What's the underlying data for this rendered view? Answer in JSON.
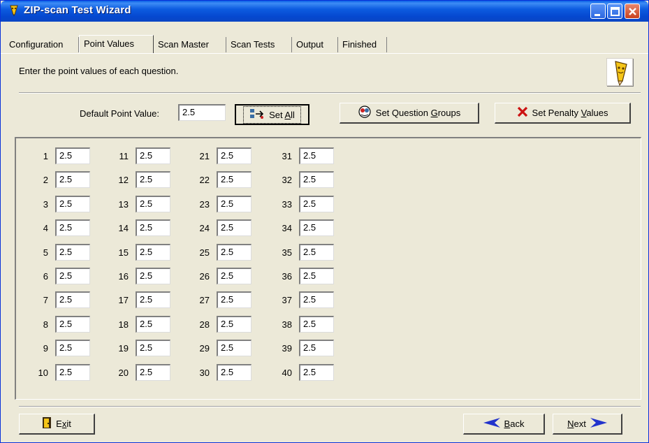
{
  "window": {
    "title": "ZIP-scan Test Wizard",
    "icon": "pencil-icon",
    "controls": [
      "minimize",
      "maximize",
      "close"
    ]
  },
  "tabs": [
    {
      "label": "Configuration",
      "active": false
    },
    {
      "label": "Point Values",
      "active": true
    },
    {
      "label": "Scan Master",
      "active": false
    },
    {
      "label": "Scan Tests",
      "active": false
    },
    {
      "label": "Output",
      "active": false
    },
    {
      "label": "Finished",
      "active": false
    }
  ],
  "instruction": "Enter the point values of each question.",
  "default_point": {
    "label": "Default Point Value:",
    "value": "2.5"
  },
  "buttons": {
    "set_all": {
      "label_pre": "Set ",
      "label_u": "A",
      "label_post": "ll"
    },
    "set_groups": {
      "label_pre": "Set Question ",
      "label_u": "G",
      "label_post": "roups"
    },
    "set_penalty": {
      "label_pre": "Set Penalty ",
      "label_u": "V",
      "label_post": "alues"
    },
    "exit": {
      "label_pre": "E",
      "label_u": "x",
      "label_post": "it"
    },
    "back": {
      "label_pre": "",
      "label_u": "B",
      "label_post": "ack"
    },
    "next": {
      "label_pre": "",
      "label_u": "N",
      "label_post": "ext"
    }
  },
  "questions": [
    {
      "num": "1",
      "value": "2.5"
    },
    {
      "num": "2",
      "value": "2.5"
    },
    {
      "num": "3",
      "value": "2.5"
    },
    {
      "num": "4",
      "value": "2.5"
    },
    {
      "num": "5",
      "value": "2.5"
    },
    {
      "num": "6",
      "value": "2.5"
    },
    {
      "num": "7",
      "value": "2.5"
    },
    {
      "num": "8",
      "value": "2.5"
    },
    {
      "num": "9",
      "value": "2.5"
    },
    {
      "num": "10",
      "value": "2.5"
    },
    {
      "num": "11",
      "value": "2.5"
    },
    {
      "num": "12",
      "value": "2.5"
    },
    {
      "num": "13",
      "value": "2.5"
    },
    {
      "num": "14",
      "value": "2.5"
    },
    {
      "num": "15",
      "value": "2.5"
    },
    {
      "num": "16",
      "value": "2.5"
    },
    {
      "num": "17",
      "value": "2.5"
    },
    {
      "num": "18",
      "value": "2.5"
    },
    {
      "num": "19",
      "value": "2.5"
    },
    {
      "num": "20",
      "value": "2.5"
    },
    {
      "num": "21",
      "value": "2.5"
    },
    {
      "num": "22",
      "value": "2.5"
    },
    {
      "num": "23",
      "value": "2.5"
    },
    {
      "num": "24",
      "value": "2.5"
    },
    {
      "num": "25",
      "value": "2.5"
    },
    {
      "num": "26",
      "value": "2.5"
    },
    {
      "num": "27",
      "value": "2.5"
    },
    {
      "num": "28",
      "value": "2.5"
    },
    {
      "num": "29",
      "value": "2.5"
    },
    {
      "num": "30",
      "value": "2.5"
    },
    {
      "num": "31",
      "value": "2.5"
    },
    {
      "num": "32",
      "value": "2.5"
    },
    {
      "num": "33",
      "value": "2.5"
    },
    {
      "num": "34",
      "value": "2.5"
    },
    {
      "num": "35",
      "value": "2.5"
    },
    {
      "num": "36",
      "value": "2.5"
    },
    {
      "num": "37",
      "value": "2.5"
    },
    {
      "num": "38",
      "value": "2.5"
    },
    {
      "num": "39",
      "value": "2.5"
    },
    {
      "num": "40",
      "value": "2.5"
    }
  ]
}
